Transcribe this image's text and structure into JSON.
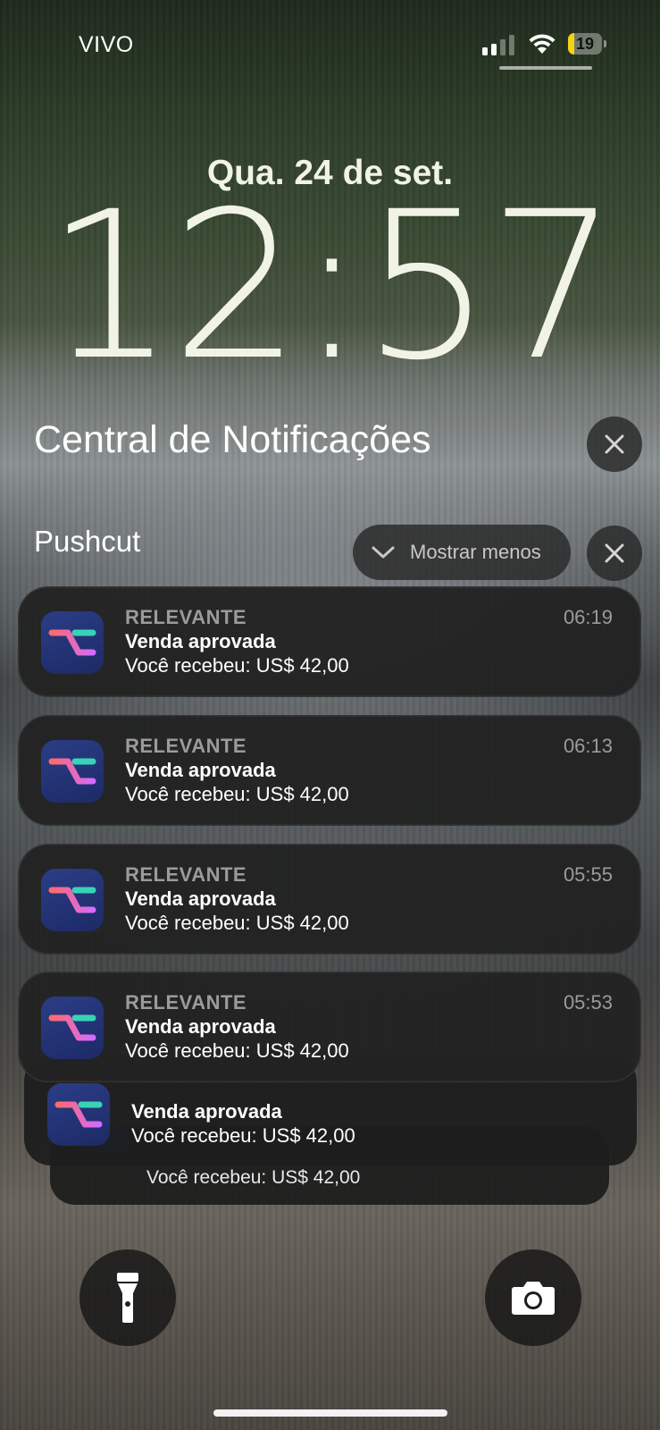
{
  "status_bar": {
    "carrier": "VIVO",
    "battery_level": "19",
    "battery_fraction": 0.19,
    "battery_color": "#f5d313",
    "icons": [
      "cellular-signal-icon",
      "wifi-icon",
      "battery-charging-icon"
    ]
  },
  "lock_screen": {
    "date": "Qua. 24 de set.",
    "time": "12:57"
  },
  "notification_center": {
    "title": "Central de Notificações",
    "group": {
      "name": "Pushcut",
      "show_less_label": "Mostrar menos"
    },
    "notifications": [
      {
        "app": "RELEVANTE",
        "time": "06:19",
        "title": "Venda aprovada",
        "body": "Você recebeu: US$ 42,00"
      },
      {
        "app": "RELEVANTE",
        "time": "06:13",
        "title": "Venda aprovada",
        "body": "Você recebeu: US$ 42,00"
      },
      {
        "app": "RELEVANTE",
        "time": "05:55",
        "title": "Venda aprovada",
        "body": "Você recebeu: US$ 42,00"
      },
      {
        "app": "RELEVANTE",
        "time": "05:53",
        "title": "Venda aprovada",
        "body": "Você recebeu: US$ 42,00"
      }
    ],
    "stacked": [
      {
        "title": "Venda aprovada",
        "body": "Você recebeu: US$ 42,00"
      },
      {
        "body": "Você recebeu: US$ 42,00"
      }
    ]
  },
  "quick_actions": {
    "left": "flashlight-icon",
    "right": "camera-icon"
  }
}
